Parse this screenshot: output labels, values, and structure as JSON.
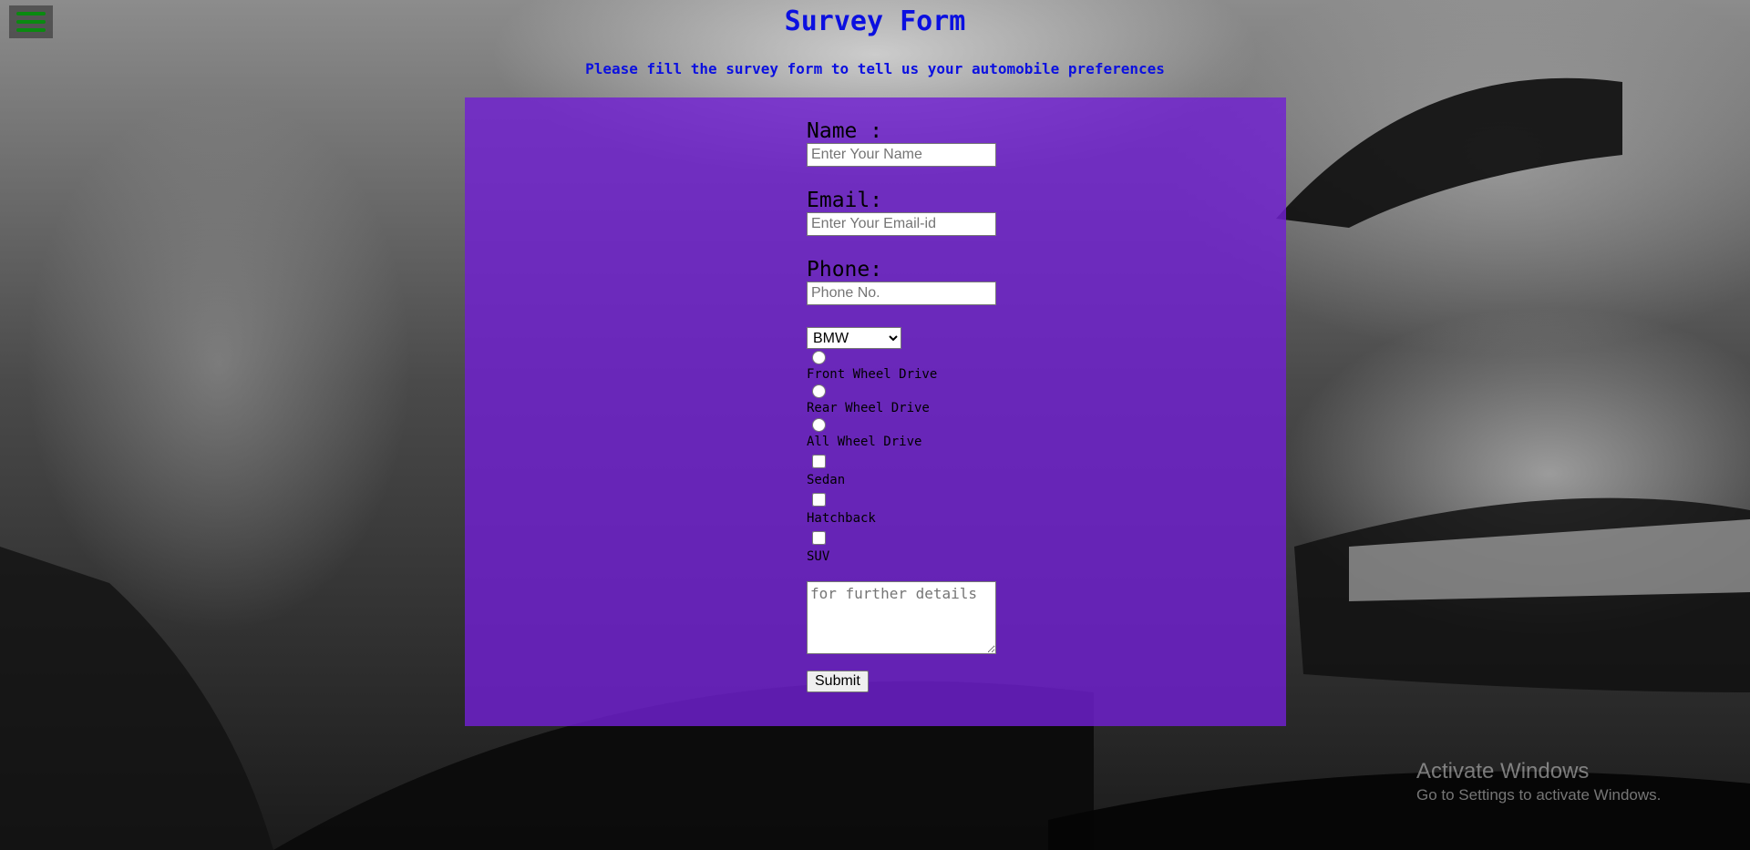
{
  "menu": {
    "icon": "hamburger-menu-icon",
    "icon_color": "#0a8a10"
  },
  "header": {
    "title": "Survey Form",
    "subtitle": "Please fill the survey form to tell us your automobile preferences",
    "color": "#0b10e0"
  },
  "form": {
    "panel_color": "#7020d2",
    "name": {
      "label": "Name :",
      "placeholder": "Enter Your Name",
      "value": ""
    },
    "email": {
      "label": "Email:",
      "placeholder": "Enter Your Email-id",
      "value": ""
    },
    "phone": {
      "label": "Phone:",
      "placeholder": "Phone No.",
      "value": ""
    },
    "brand_select": {
      "selected": "BMW"
    },
    "drive_options": [
      {
        "label": "Front Wheel Drive",
        "checked": false
      },
      {
        "label": "Rear Wheel Drive",
        "checked": false
      },
      {
        "label": "All Wheel Drive",
        "checked": false
      }
    ],
    "body_types": [
      {
        "label": "Sedan",
        "checked": false
      },
      {
        "label": "Hatchback",
        "checked": false
      },
      {
        "label": "SUV",
        "checked": false
      }
    ],
    "details": {
      "placeholder": "for further details",
      "value": ""
    },
    "submit_label": "Submit"
  },
  "watermark": {
    "title": "Activate Windows",
    "subtitle": "Go to Settings to activate Windows."
  }
}
